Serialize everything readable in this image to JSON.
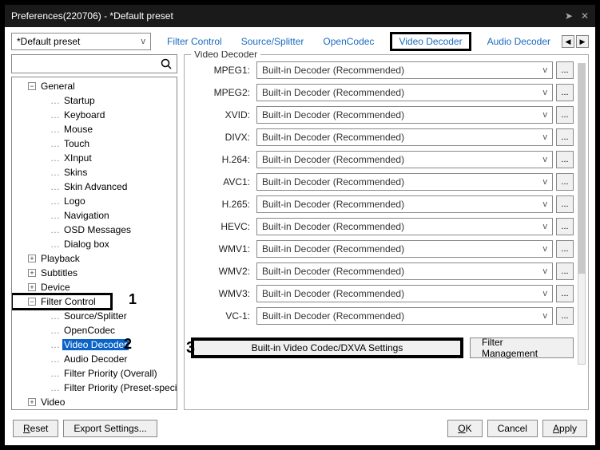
{
  "window": {
    "title": "Preferences(220706) - *Default preset"
  },
  "preset": {
    "value": "*Default preset"
  },
  "tabs": {
    "items": [
      "Filter Control",
      "Source/Splitter",
      "OpenCodec",
      "Video Decoder",
      "Audio Decoder"
    ],
    "active": "Video Decoder"
  },
  "tree": {
    "items": [
      {
        "label": "General",
        "level": 1,
        "expandable": true,
        "expanded": true
      },
      {
        "label": "Startup",
        "level": 2
      },
      {
        "label": "Keyboard",
        "level": 2
      },
      {
        "label": "Mouse",
        "level": 2
      },
      {
        "label": "Touch",
        "level": 2
      },
      {
        "label": "XInput",
        "level": 2
      },
      {
        "label": "Skins",
        "level": 2
      },
      {
        "label": "Skin Advanced",
        "level": 2
      },
      {
        "label": "Logo",
        "level": 2
      },
      {
        "label": "Navigation",
        "level": 2
      },
      {
        "label": "OSD Messages",
        "level": 2
      },
      {
        "label": "Dialog box",
        "level": 2
      },
      {
        "label": "Playback",
        "level": 1,
        "expandable": true,
        "expanded": false
      },
      {
        "label": "Subtitles",
        "level": 1,
        "expandable": true,
        "expanded": false
      },
      {
        "label": "Device",
        "level": 1,
        "expandable": true,
        "expanded": false
      },
      {
        "label": "Filter Control",
        "level": 1,
        "expandable": true,
        "expanded": true,
        "boxed": 1
      },
      {
        "label": "Source/Splitter",
        "level": 3
      },
      {
        "label": "OpenCodec",
        "level": 3
      },
      {
        "label": "Video Decoder",
        "level": 3,
        "selected": true,
        "callout": 2
      },
      {
        "label": "Audio Decoder",
        "level": 3
      },
      {
        "label": "Filter Priority (Overall)",
        "level": 3
      },
      {
        "label": "Filter Priority (Preset-specific)",
        "level": 3
      },
      {
        "label": "Video",
        "level": 1,
        "expandable": true,
        "expanded": false
      }
    ]
  },
  "panel": {
    "title": "Video Decoder",
    "rows": [
      {
        "label": "MPEG1:",
        "value": "Built-in Decoder (Recommended)"
      },
      {
        "label": "MPEG2:",
        "value": "Built-in Decoder (Recommended)"
      },
      {
        "label": "XVID:",
        "value": "Built-in Decoder (Recommended)"
      },
      {
        "label": "DIVX:",
        "value": "Built-in Decoder (Recommended)"
      },
      {
        "label": "H.264:",
        "value": "Built-in Decoder (Recommended)"
      },
      {
        "label": "AVC1:",
        "value": "Built-in Decoder (Recommended)"
      },
      {
        "label": "H.265:",
        "value": "Built-in Decoder (Recommended)"
      },
      {
        "label": "HEVC:",
        "value": "Built-in Decoder (Recommended)"
      },
      {
        "label": "WMV1:",
        "value": "Built-in Decoder (Recommended)"
      },
      {
        "label": "WMV2:",
        "value": "Built-in Decoder (Recommended)"
      },
      {
        "label": "WMV3:",
        "value": "Built-in Decoder (Recommended)"
      },
      {
        "label": "VC-1:",
        "value": "Built-in Decoder (Recommended)"
      }
    ],
    "more_label": "...",
    "dxva_btn": "Built-in Video Codec/DXVA Settings",
    "filter_mgmt_btn": "Filter Management",
    "callout": 3
  },
  "footer": {
    "reset": "Reset",
    "export": "Export Settings...",
    "ok": "OK",
    "cancel": "Cancel",
    "apply": "Apply"
  }
}
